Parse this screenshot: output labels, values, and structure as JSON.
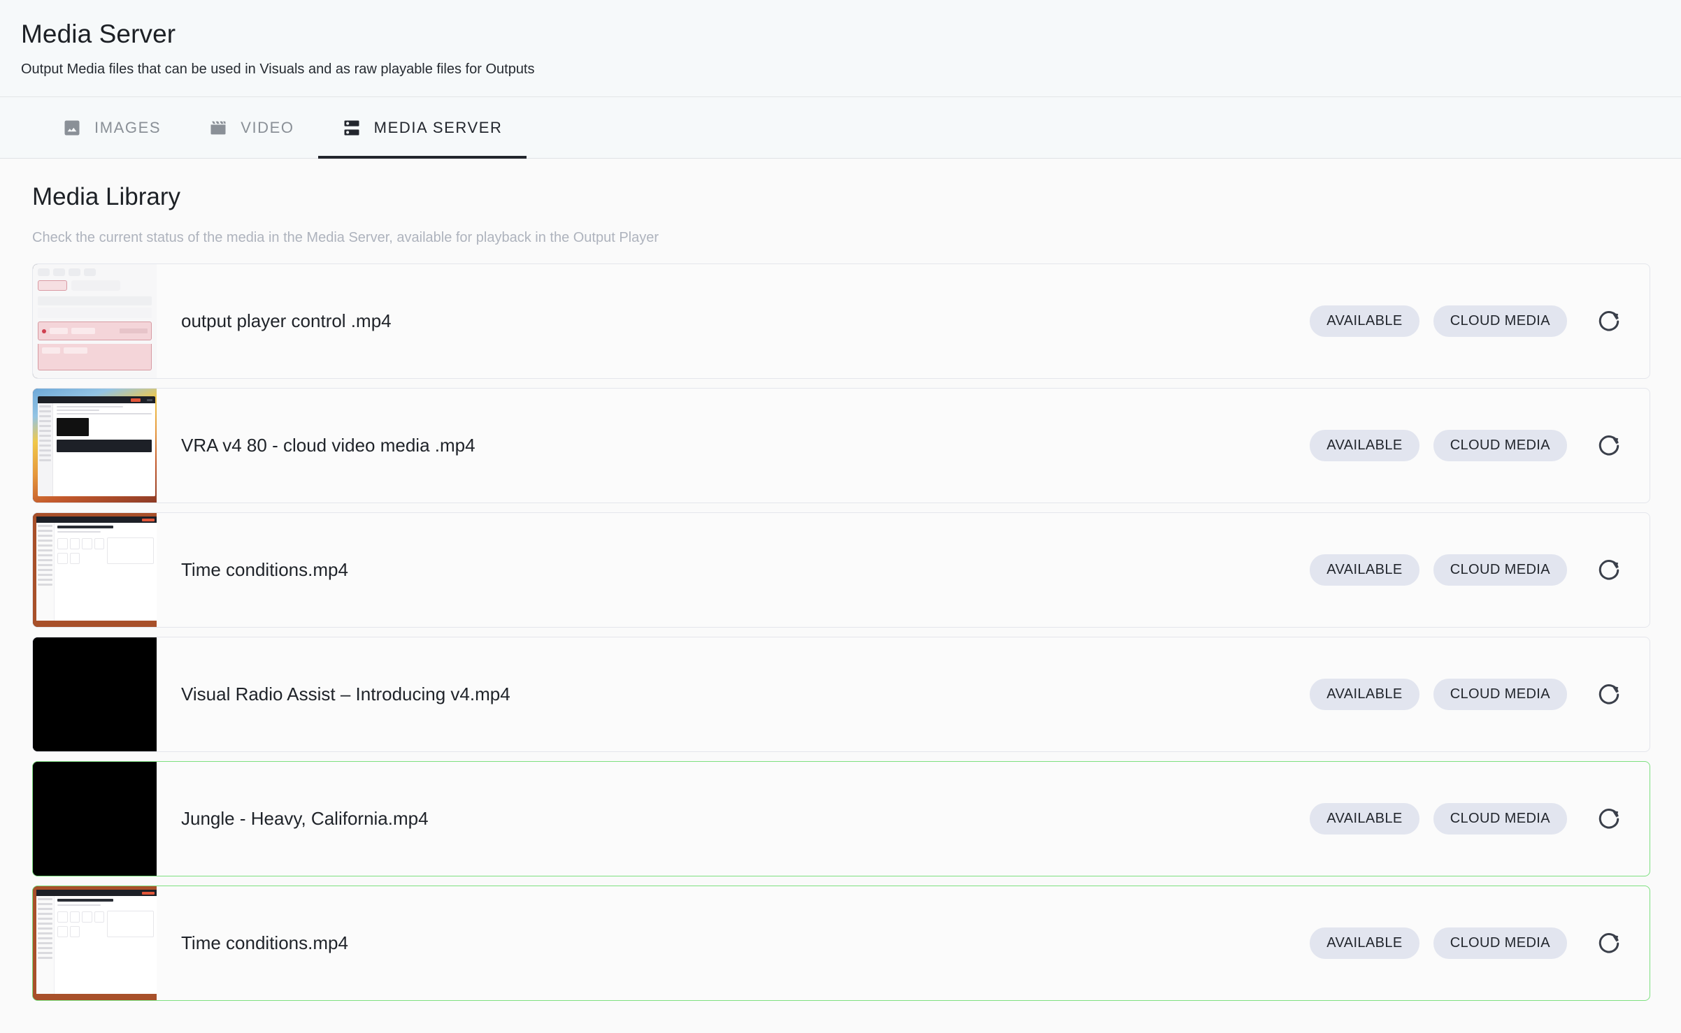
{
  "header": {
    "title": "Media Server",
    "subtitle": "Output Media files that can be used in Visuals and as raw playable files for Outputs"
  },
  "tabs": [
    {
      "label": "IMAGES",
      "icon": "image-icon",
      "active": false
    },
    {
      "label": "VIDEO",
      "icon": "movie-icon",
      "active": false
    },
    {
      "label": "MEDIA SERVER",
      "icon": "dns-icon",
      "active": true
    }
  ],
  "library": {
    "title": "Media Library",
    "subtitle": "Check the current status of the media in the Media Server, available for playback in the Output Player"
  },
  "rows": [
    {
      "name": "output player control .mp4",
      "status": "AVAILABLE",
      "source": "CLOUD MEDIA",
      "refresh_icon": "refresh-icon",
      "thumb": "player-control",
      "highlight": false
    },
    {
      "name": "VRA v4 80 - cloud video media .mp4",
      "status": "AVAILABLE",
      "source": "CLOUD MEDIA",
      "refresh_icon": "refresh-icon",
      "thumb": "browser-desktop",
      "highlight": false
    },
    {
      "name": "Time conditions.mp4",
      "status": "AVAILABLE",
      "source": "CLOUD MEDIA",
      "refresh_icon": "refresh-icon",
      "thumb": "dashboard",
      "highlight": false
    },
    {
      "name": "Visual Radio Assist – Introducing v4.mp4",
      "status": "AVAILABLE",
      "source": "CLOUD MEDIA",
      "refresh_icon": "refresh-icon",
      "thumb": "black",
      "highlight": false
    },
    {
      "name": "Jungle - Heavy, California.mp4",
      "status": "AVAILABLE",
      "source": "CLOUD MEDIA",
      "refresh_icon": "refresh-icon",
      "thumb": "black",
      "highlight": true
    },
    {
      "name": "Time conditions.mp4",
      "status": "AVAILABLE",
      "source": "CLOUD MEDIA",
      "refresh_icon": "refresh-icon",
      "thumb": "dashboard",
      "highlight": true
    }
  ],
  "colors": {
    "header_bg": "#f6f9fa",
    "content_bg": "#fafafa",
    "badge_bg": "#e2e5ef",
    "accent_dark": "#22262d",
    "highlight_border": "#7ee080",
    "row_border": "#e4e6ec",
    "muted_text": "#aeb3bd"
  }
}
